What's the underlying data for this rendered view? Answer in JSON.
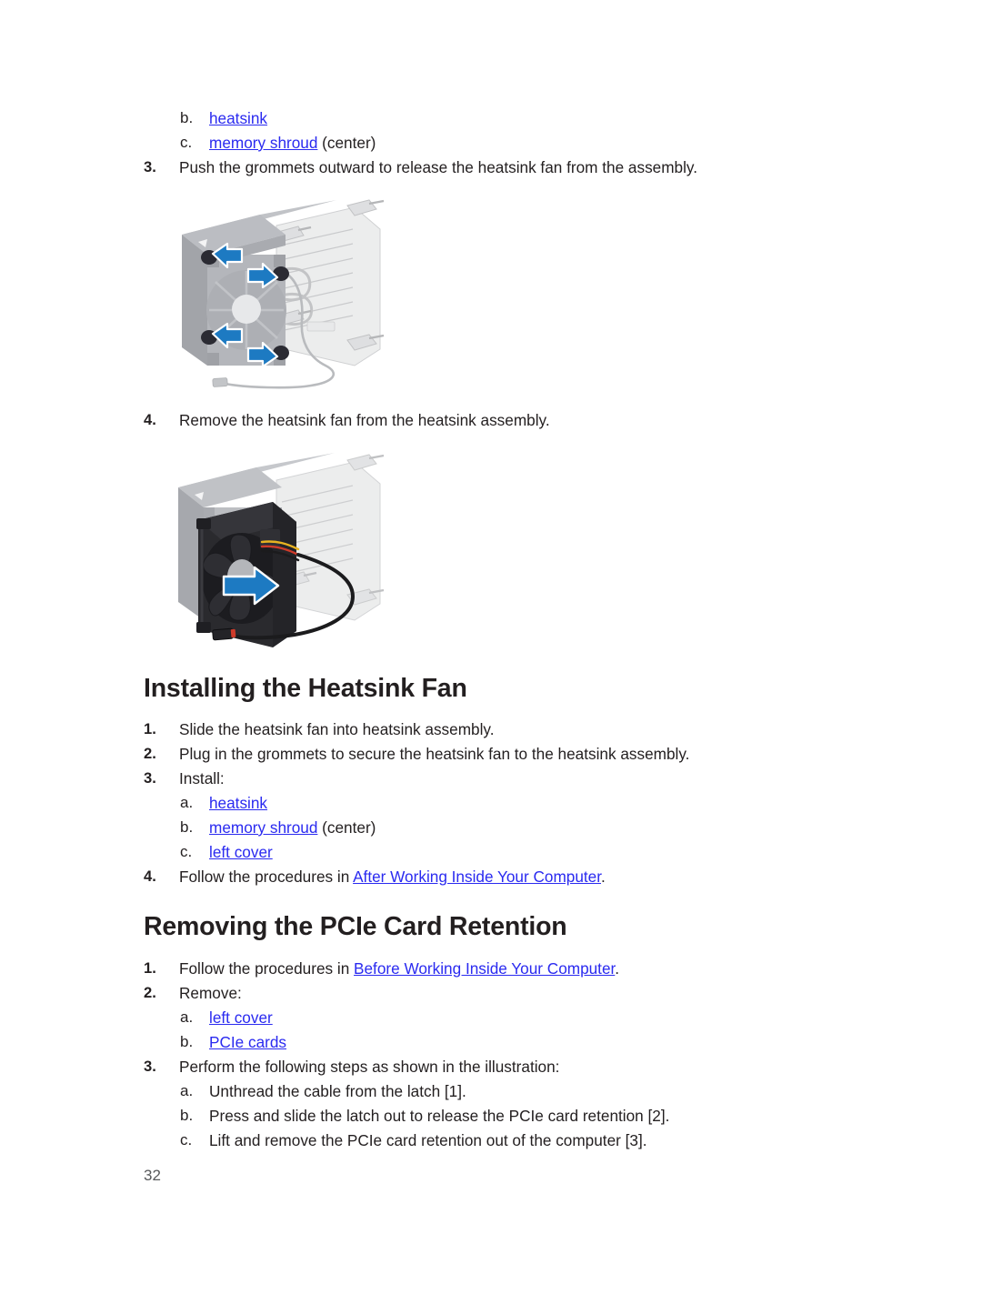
{
  "page": {
    "number": "32"
  },
  "top_list": {
    "items": [
      {
        "marker": "b.",
        "link": "heatsink",
        "tail": ""
      },
      {
        "marker": "c.",
        "link": "memory shroud",
        "tail": " (center)"
      }
    ]
  },
  "step3_top": {
    "marker": "3.",
    "text": "Push the grommets outward to release the heatsink fan from the assembly."
  },
  "figure1": {
    "name": "heatsink-fan-grommet-release-illustration",
    "alt": "Heatsink assembly with fan; four black grommets with blue arrows pointing outward",
    "colors": {
      "arrow_blue": "#1d7ac2",
      "arrow_outline": "#ffffff",
      "grommet": "#2b2b33",
      "shroud_gray": "#a8aab0",
      "shroud_gray_dark": "#8e9096",
      "heatsink_light": "#e3e4e6",
      "cable": "#b9bbbe"
    },
    "arrow_count": 4,
    "grommet_count": 4
  },
  "step4_top": {
    "marker": "4.",
    "text": "Remove the heatsink fan from the heatsink assembly."
  },
  "figure2": {
    "name": "heatsink-fan-removal-illustration",
    "alt": "Heatsink assembly with black fan being pulled out; blue arrow points right; cable with connector",
    "colors": {
      "arrow_blue": "#1d7ac2",
      "arrow_outline": "#ffffff",
      "fan_black": "#232327",
      "fan_hub": "#b4b6ba",
      "shroud_gray": "#a8aab0",
      "heatsink_light": "#e3e4e6",
      "cable": "#1b1b1d",
      "wire_yellow": "#e8b321",
      "wire_red": "#cf3b2a",
      "wire_black": "#1b1b1d"
    }
  },
  "section_installing": {
    "heading": "Installing the Heatsink Fan",
    "steps": [
      {
        "marker": "1.",
        "text": "Slide the heatsink fan into heatsink assembly."
      },
      {
        "marker": "2.",
        "text": "Plug in the grommets to secure the heatsink fan to the heatsink assembly."
      },
      {
        "marker": "3.",
        "text": "Install:"
      }
    ],
    "install_items": [
      {
        "marker": "a.",
        "link": "heatsink",
        "tail": ""
      },
      {
        "marker": "b.",
        "link": "memory shroud",
        "tail": " (center)"
      },
      {
        "marker": "c.",
        "link": "left cover",
        "tail": ""
      }
    ],
    "step4": {
      "marker": "4.",
      "prefix": "Follow the procedures in ",
      "link": "After Working Inside Your Computer",
      "tail": "."
    }
  },
  "section_removing_pcie": {
    "heading": "Removing the PCIe Card Retention",
    "step1": {
      "marker": "1.",
      "prefix": "Follow the procedures in ",
      "link": "Before Working Inside Your Computer",
      "tail": "."
    },
    "step2": {
      "marker": "2.",
      "text": "Remove:"
    },
    "remove_items": [
      {
        "marker": "a.",
        "link": "left cover",
        "tail": ""
      },
      {
        "marker": "b.",
        "link": "PCIe cards",
        "tail": ""
      }
    ],
    "step3": {
      "marker": "3.",
      "text": "Perform the following steps as shown in the illustration:"
    },
    "step3_items": [
      {
        "marker": "a.",
        "text": "Unthread the cable from the latch [1]."
      },
      {
        "marker": "b.",
        "text": "Press and slide the latch out to release the PCIe card retention [2]."
      },
      {
        "marker": "c.",
        "text": "Lift and remove the PCIe card retention out of the computer [3]."
      }
    ]
  }
}
